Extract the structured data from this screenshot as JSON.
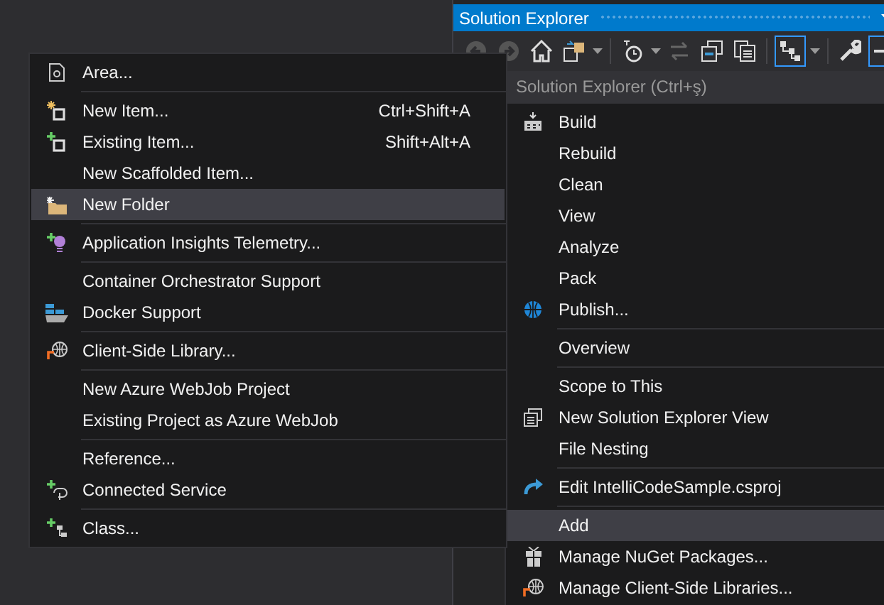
{
  "panel": {
    "title": "Solution Explorer",
    "search": {
      "placeholder": "Solution Explorer (Ctrl+ş)"
    }
  },
  "toolbar": [
    {
      "selected": false
    },
    {
      "selected": false
    },
    {
      "selected": false
    },
    {
      "selected": false
    },
    {
      "selected": false
    },
    {
      "selected": false
    },
    {
      "selected": false
    },
    {
      "selected": false
    },
    {
      "selected": true
    },
    {
      "selected": false
    },
    {
      "selected": true
    }
  ],
  "context_menu": {
    "items": [
      {
        "label": "Build",
        "separator_before": false,
        "selected": false
      },
      {
        "label": "Rebuild",
        "separator_before": false,
        "selected": false
      },
      {
        "label": "Clean",
        "separator_before": false,
        "selected": false
      },
      {
        "label": "View",
        "separator_before": false,
        "selected": false
      },
      {
        "label": "Analyze",
        "separator_before": false,
        "selected": false
      },
      {
        "label": "Pack",
        "separator_before": false,
        "selected": false
      },
      {
        "label": "Publish...",
        "separator_before": false,
        "selected": false
      },
      {
        "label": "Overview",
        "separator_before": true,
        "selected": false
      },
      {
        "label": "Scope to This",
        "separator_before": true,
        "selected": false
      },
      {
        "label": "New Solution Explorer View",
        "separator_before": false,
        "selected": false
      },
      {
        "label": "File Nesting",
        "separator_before": false,
        "selected": false
      },
      {
        "label": "Edit IntelliCodeSample.csproj",
        "separator_before": true,
        "selected": false
      },
      {
        "label": "Add",
        "separator_before": true,
        "selected": true
      },
      {
        "label": "Manage NuGet Packages...",
        "separator_before": false,
        "selected": false
      },
      {
        "label": "Manage Client-Side Libraries...",
        "separator_before": false,
        "selected": false
      }
    ]
  },
  "add_submenu": {
    "items": [
      {
        "label": "Area...",
        "separator_before": false,
        "selected": false
      },
      {
        "label": "New Item...",
        "shortcut": "Ctrl+Shift+A",
        "separator_before": true,
        "selected": false
      },
      {
        "label": "Existing Item...",
        "shortcut": "Shift+Alt+A",
        "separator_before": false,
        "selected": false
      },
      {
        "label": "New Scaffolded Item...",
        "separator_before": false,
        "selected": false
      },
      {
        "label": "New Folder",
        "separator_before": false,
        "selected": true
      },
      {
        "label": "Application Insights Telemetry...",
        "separator_before": true,
        "selected": false
      },
      {
        "label": "Container Orchestrator Support",
        "separator_before": true,
        "selected": false
      },
      {
        "label": "Docker Support",
        "separator_before": false,
        "selected": false
      },
      {
        "label": "Client-Side Library...",
        "separator_before": true,
        "selected": false
      },
      {
        "label": "New Azure WebJob Project",
        "separator_before": true,
        "selected": false
      },
      {
        "label": "Existing Project as Azure WebJob",
        "separator_before": false,
        "selected": false
      },
      {
        "label": "Reference...",
        "separator_before": true,
        "selected": false
      },
      {
        "label": "Connected Service",
        "separator_before": false,
        "selected": false
      },
      {
        "label": "Class...",
        "separator_before": true,
        "selected": false
      }
    ]
  }
}
